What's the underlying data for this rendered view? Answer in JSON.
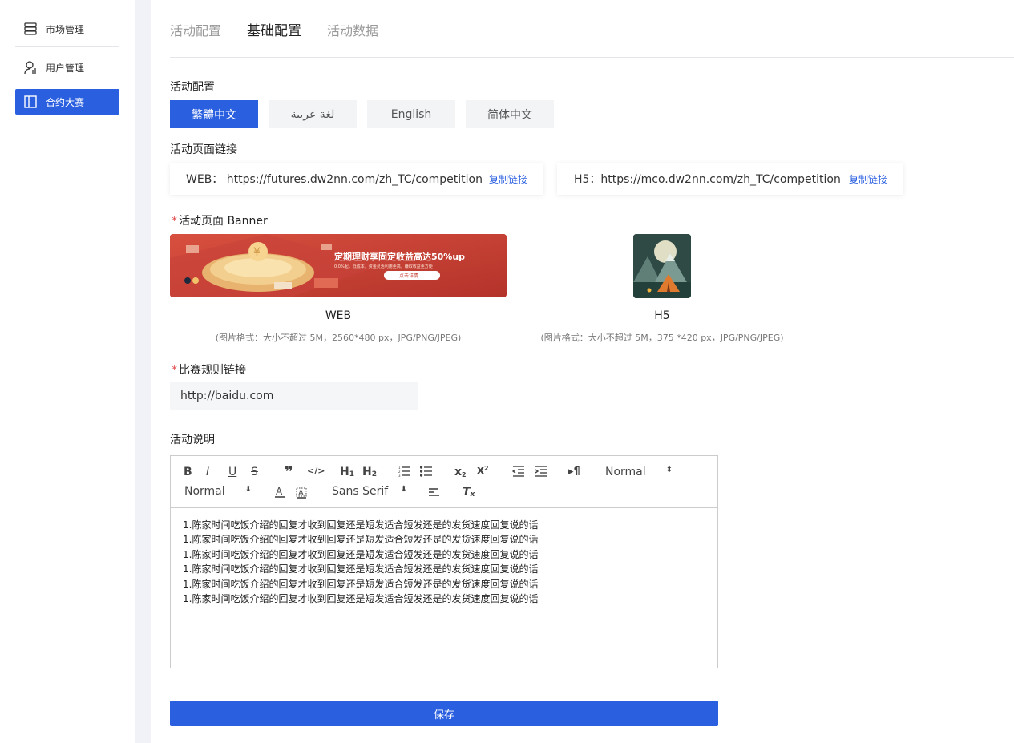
{
  "sidebar": {
    "items": [
      {
        "label": "市场管理",
        "icon": "server-icon"
      },
      {
        "label": "用户管理",
        "icon": "user-chart-icon"
      },
      {
        "label": "合约大赛",
        "icon": "layout-icon"
      }
    ]
  },
  "tabs": [
    {
      "label": "活动配置"
    },
    {
      "label": "基础配置"
    },
    {
      "label": "活动数据"
    }
  ],
  "section": {
    "activity_config": "活动配置",
    "page_link": "活动页面链接",
    "banner": "活动页面 Banner",
    "rules_link": "比赛规则链接",
    "description": "活动说明"
  },
  "languages": [
    "繁體中文",
    "لغة عربية",
    "English",
    "简体中文"
  ],
  "links": {
    "web": {
      "text": "WEB： https://futures.dw2nn.com/zh_TC/competition",
      "copy": "复制链接"
    },
    "h5": {
      "text": "H5：https://mco.dw2nn.com/zh_TC/competition",
      "copy": "复制链接"
    }
  },
  "banners": {
    "web": {
      "caption": "WEB",
      "hint": "(图片格式：大小不超过 5M，2560*480 px，JPG/PNG/JPEG)",
      "text_main": "定期理财享固定收益高达50%up",
      "text_sub": "0.0%起，低成本，资金灵活利用更高，赚取收益更方便",
      "cta": "点击详情"
    },
    "h5": {
      "caption": "H5",
      "hint": "(图片格式：大小不超过 5M，375 *420 px，JPG/PNG/JPEG)"
    }
  },
  "rules_input": {
    "value": "http://baidu.com"
  },
  "editor": {
    "header_select": "Normal",
    "size_select": "Normal",
    "font_select": "Sans Serif",
    "lines": [
      "1.陈家时间吃饭介绍的回复才收到回复还是短发适合短发还是的发货速度回复说的话",
      "1.陈家时间吃饭介绍的回复才收到回复还是短发适合短发还是的发货速度回复说的话",
      "1.陈家时间吃饭介绍的回复才收到回复还是短发适合短发还是的发货速度回复说的话",
      "1.陈家时间吃饭介绍的回复才收到回复还是短发适合短发还是的发货速度回复说的话",
      "1.陈家时间吃饭介绍的回复才收到回复还是短发适合短发还是的发货速度回复说的话",
      "1.陈家时间吃饭介绍的回复才收到回复还是短发适合短发还是的发货速度回复说的话"
    ]
  },
  "save_label": "保存",
  "colors": {
    "accent": "#2a5fe0",
    "required": "#e34d4d"
  }
}
